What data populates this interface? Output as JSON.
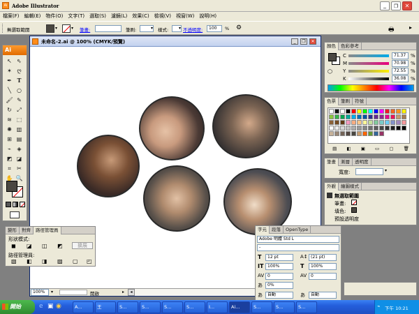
{
  "title": "Adobe Illustrator",
  "menu": [
    "檔案(F)",
    "編輯(E)",
    "物件(O)",
    "文字(T)",
    "選取(S)",
    "濾鏡(L)",
    "效果(C)",
    "檢視(V)",
    "視窗(W)",
    "說明(H)"
  ],
  "control": {
    "selection": "無選取範圍",
    "stroke_label": "筆畫:",
    "brush_label": "筆刷:",
    "style_label": "樣式:",
    "opacity_label": "不透明度:",
    "opacity_value": "100",
    "percent": "%"
  },
  "tools": {
    "ai_logo": "Ai"
  },
  "document": {
    "title": "未命名-2.ai @ 100% (CMYK/預覽)",
    "zoom": "100%",
    "status": "開啟"
  },
  "color_panel": {
    "tabs": [
      "顏色",
      "色彩參考"
    ],
    "channels": [
      {
        "label": "C",
        "value": "71.37"
      },
      {
        "label": "M",
        "value": "70.98"
      },
      {
        "label": "Y",
        "value": "72.55"
      },
      {
        "label": "K",
        "value": "36.08"
      }
    ],
    "percent": "%"
  },
  "swatch_panel": {
    "tabs": [
      "色票",
      "筆刷",
      "符號"
    ]
  },
  "stroke_panel": {
    "tabs": [
      "筆畫",
      "漸層",
      "透明度"
    ],
    "width_label": "寬度:"
  },
  "appearance_panel": {
    "tabs": [
      "外觀",
      "繪圖樣式"
    ],
    "title": "無選取範圍",
    "rows": [
      "筆畫:",
      "填色:",
      "預設透明度"
    ]
  },
  "pathfinder_panel": {
    "tabs": [
      "變形",
      "對齊",
      "路徑管理員"
    ],
    "shape_label": "形狀模式:",
    "expand": "擴展",
    "pf_label": "路徑管理員:"
  },
  "char_panel": {
    "tabs": [
      "字元",
      "段落",
      "OpenType"
    ],
    "font": "Adobe 明體 Std L",
    "style": "-",
    "size": "12 pt",
    "leading": "(21 pt)",
    "hscale": "100%",
    "vscale": "100%",
    "kern": "0",
    "track": "0",
    "baseline": "0%",
    "rotate": "0°",
    "auto1": "自動",
    "auto2": "自動"
  },
  "taskbar": {
    "start": "開始",
    "items": [
      "A...",
      "王",
      "S...",
      "S...",
      "S...",
      "S...",
      "I...",
      "Ai...",
      "S...",
      "S...",
      "S...",
      "S..."
    ],
    "time": "下午 10:21"
  },
  "colors": {
    "fill": "#4a4741",
    "swatches": [
      "#ffffff",
      "#000000",
      "#ff0000",
      "#ffff00",
      "#00ff00",
      "#00ffff",
      "#0000ff",
      "#ff00ff",
      "#f7941d",
      "#8dc63f",
      "#00a99d",
      "#662d91"
    ]
  }
}
